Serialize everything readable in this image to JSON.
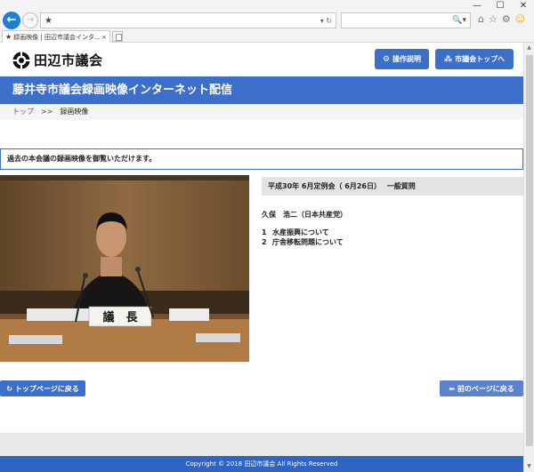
{
  "browser": {
    "tab_title": "録画映像 | 田辺市議会インタ...",
    "tab_close": "×",
    "address_star": "★",
    "address_tools": "▾ ↻",
    "search_tools": "🔍▾",
    "win_minimize": "—",
    "win_maximize": "☐",
    "win_close": "✕"
  },
  "header": {
    "site_title": "田辺市議会",
    "help_label": "操作説明",
    "council_top_label": "市議会トップへ"
  },
  "banner": {
    "title": "藤井寺市議会録画映像インターネット配信"
  },
  "breadcrumb": {
    "top": "トップ",
    "separator": ">>",
    "current": "録画映像"
  },
  "notice": {
    "text": "過去の本会議の録画映像を御覧いただけます。"
  },
  "video": {
    "nameplate": "議　長"
  },
  "meeting": {
    "session": "平成30年 6月定例会（ 6月26日）",
    "type": "一般質問",
    "speaker": "久保　浩二（日本共産党）",
    "topics": [
      {
        "num": "1",
        "text": "水産振興について"
      },
      {
        "num": "2",
        "text": "庁舎移転問題について"
      }
    ]
  },
  "nav": {
    "home_label": "トップページに戻る",
    "prev_label": "前のページに戻る"
  },
  "footer": {
    "copyright": "Copyright © 2018 田辺市議会 All Rights Reserved"
  },
  "colors": {
    "accent": "#3b6fc9",
    "footer": "#2f64c4",
    "breadcrumb_link": "#7a3b8c"
  }
}
